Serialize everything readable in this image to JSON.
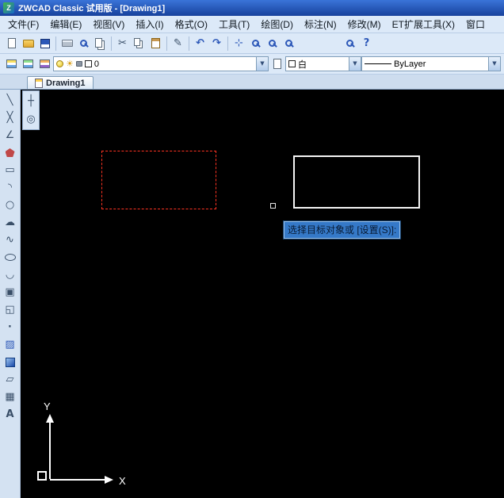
{
  "window": {
    "title": "ZWCAD Classic 试用版 - [Drawing1]",
    "logo_letter": "Z"
  },
  "menu": {
    "items": [
      "文件(F)",
      "编辑(E)",
      "视图(V)",
      "插入(I)",
      "格式(O)",
      "工具(T)",
      "绘图(D)",
      "标注(N)",
      "修改(M)",
      "ET扩展工具(X)",
      "窗口"
    ]
  },
  "toolbar_row2": {
    "layer_value": "0",
    "color_value": "白",
    "linetype_value": "ByLayer"
  },
  "tab": {
    "label": "Drawing1"
  },
  "canvas": {
    "prompt": "选择目标对象或 [设置(S)]:",
    "ucs_x": "X",
    "ucs_y": "Y"
  },
  "icons": {
    "new": "css-page",
    "open": "css-folder",
    "save": "css-floppy",
    "plot": "css-printer",
    "preview": "css-magnifier",
    "publish": "css-pages",
    "cut": "✂",
    "copy": "css-copy",
    "paste": "css-clipboard",
    "match": "✎",
    "undo": "↶",
    "redo": "↷",
    "pan": "⊹",
    "zoom_realtime": "css-magnifier",
    "zoom_window": "css-magnifier",
    "zoom_previous": "css-magnifier",
    "find": "css-magnifier",
    "help": "?",
    "line": "╲",
    "construction_line": "╳",
    "polyline": "∠",
    "polygon": "css-pentagon",
    "rectangle": "▭",
    "arc": "◝",
    "circle": "○",
    "revcloud": "☁",
    "spline": "∿",
    "ellipse": "css-ellipse",
    "ellipse_arc": "◡",
    "insert_block": "▣",
    "make_block": "◱",
    "point": "∙",
    "hatch": "▨",
    "gradient": "css-gradient-square",
    "region": "▱",
    "table": "▦",
    "mtext": "A",
    "layer_bulb": "css-bulb",
    "sun": "☀",
    "layer_lock": "css-lock",
    "color_chip": "css-chip",
    "linetype_line": "css-line",
    "dropdown": "▼",
    "mini1": "┼",
    "mini2": "◎"
  },
  "colors": {
    "titlebar_blue": "#17419c",
    "toolbar_bg": "#dce9f8",
    "canvas_black": "#000000",
    "selection_red": "#ff3322",
    "entity_white": "#f5f5f5",
    "prompt_bg": "#3579c8"
  }
}
